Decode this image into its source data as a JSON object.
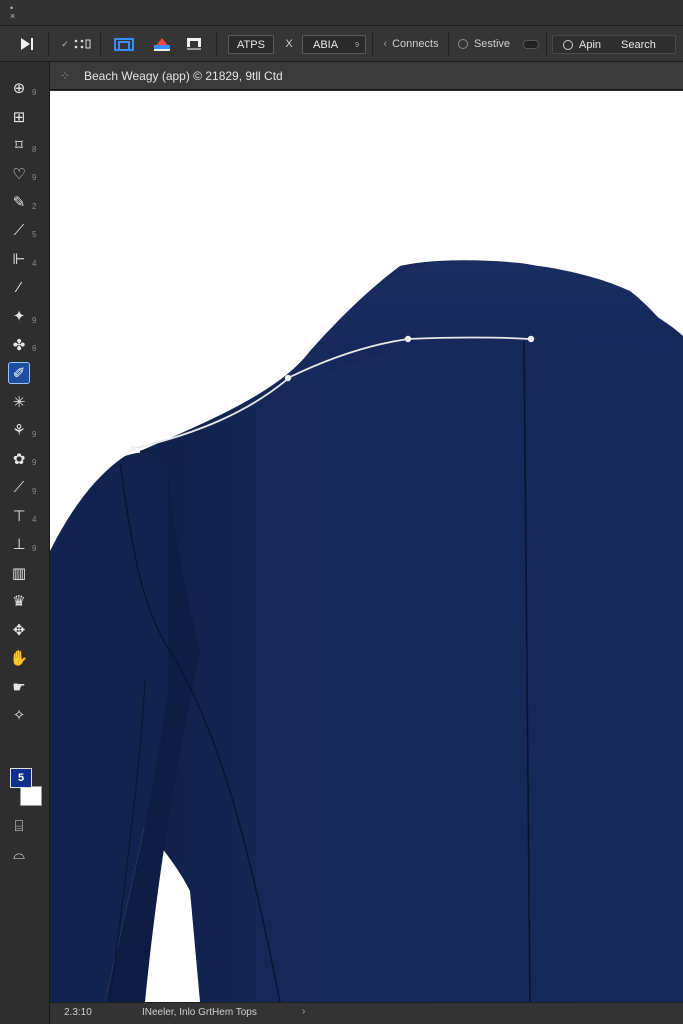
{
  "window": {
    "close_glyph": "×",
    "min_glyph": "•"
  },
  "options_bar": {
    "play_glyph": "▶",
    "align_glyphs": "⁘",
    "field_a": "ATPS",
    "field_sep": "X",
    "field_b": "ABIA",
    "field_b_suffix": "9",
    "connects_label": "Connects",
    "sestive_label": "Sestive",
    "apin_label": "Apin",
    "search_label": "Search"
  },
  "document": {
    "tab_title": "Beach Weagy (app) © 21829, 9tll Ctd"
  },
  "toolbar": {
    "tools": [
      {
        "name": "move-tool",
        "glyph": "⊕",
        "n": "9"
      },
      {
        "name": "artboard-tool",
        "glyph": "⊞",
        "n": ""
      },
      {
        "name": "marquee-tool",
        "glyph": "⌑",
        "n": "8"
      },
      {
        "name": "lasso-tool",
        "glyph": "♡",
        "n": "9"
      },
      {
        "name": "quick-select-tool",
        "glyph": "✎",
        "n": "2"
      },
      {
        "name": "crop-tool",
        "glyph": "⟋",
        "n": "5"
      },
      {
        "name": "frame-tool",
        "glyph": "⊩",
        "n": "4"
      },
      {
        "name": "eyedropper-tool",
        "glyph": "⁄",
        "n": ""
      },
      {
        "name": "healing-tool",
        "glyph": "✦",
        "n": "9"
      },
      {
        "name": "brush-tool",
        "glyph": "✤",
        "n": "6"
      },
      {
        "name": "pen-tool",
        "glyph": "✐",
        "n": ""
      },
      {
        "name": "snowflake-tool",
        "glyph": "✳",
        "n": ""
      },
      {
        "name": "stamp-tool",
        "glyph": "⚘",
        "n": "9"
      },
      {
        "name": "history-tool",
        "glyph": "✿",
        "n": "9"
      },
      {
        "name": "eraser-tool",
        "glyph": "⟋",
        "n": "9"
      },
      {
        "name": "type-tool",
        "glyph": "⊤",
        "n": "4"
      },
      {
        "name": "path-tool",
        "glyph": "⊥",
        "n": "9"
      },
      {
        "name": "gradient-tool",
        "glyph": "▥",
        "n": ""
      },
      {
        "name": "crown-tool",
        "glyph": "♛",
        "n": ""
      },
      {
        "name": "pinwheel-tool",
        "glyph": "✥",
        "n": ""
      },
      {
        "name": "hand-tool",
        "glyph": "✋",
        "n": ""
      },
      {
        "name": "finger-tool",
        "glyph": "☛",
        "n": ""
      },
      {
        "name": "zoom-tool",
        "glyph": "✧",
        "n": ""
      }
    ],
    "color_fg_label": "5",
    "extra1": "⌸",
    "extra2": "⌓"
  },
  "status": {
    "zoom": "2.3:10",
    "info": "INeeler, Inlo GrtHem Tops",
    "arrow": "›"
  },
  "colors": {
    "jacket": "#16285a",
    "jacket_shadow": "#0f1d44",
    "accent": "#1d4fa0"
  }
}
